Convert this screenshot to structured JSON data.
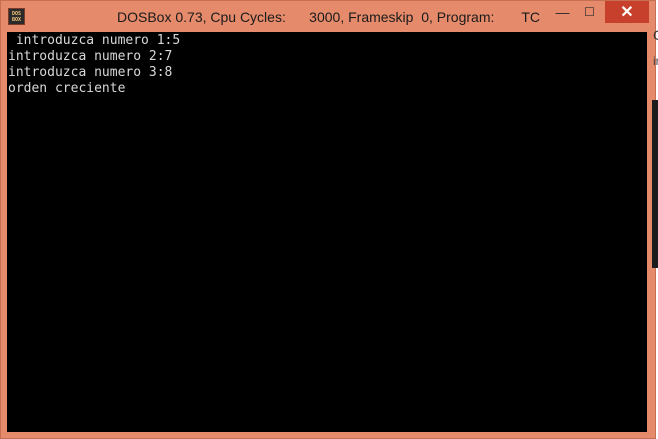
{
  "window": {
    "title": "DOSBox 0.73, Cpu Cycles:      3000, Frameskip  0, Program:       TC",
    "icon_name": "dosbox-icon",
    "icon_lines": [
      "DOS",
      "BOX"
    ],
    "controls": {
      "minimize": "—",
      "maximize": "☐",
      "close": "✕"
    },
    "accent_color": "#e58a6a",
    "close_color": "#c7402c"
  },
  "terminal": {
    "lines": [
      " introduzca numero 1:5",
      "introduzca numero 2:7",
      "introduzca numero 3:8",
      "orden creciente"
    ],
    "background": "#000000",
    "foreground": "#d8d8d8"
  },
  "background_window_edge": {
    "glyph_1": "C",
    "glyph_2": "in"
  }
}
